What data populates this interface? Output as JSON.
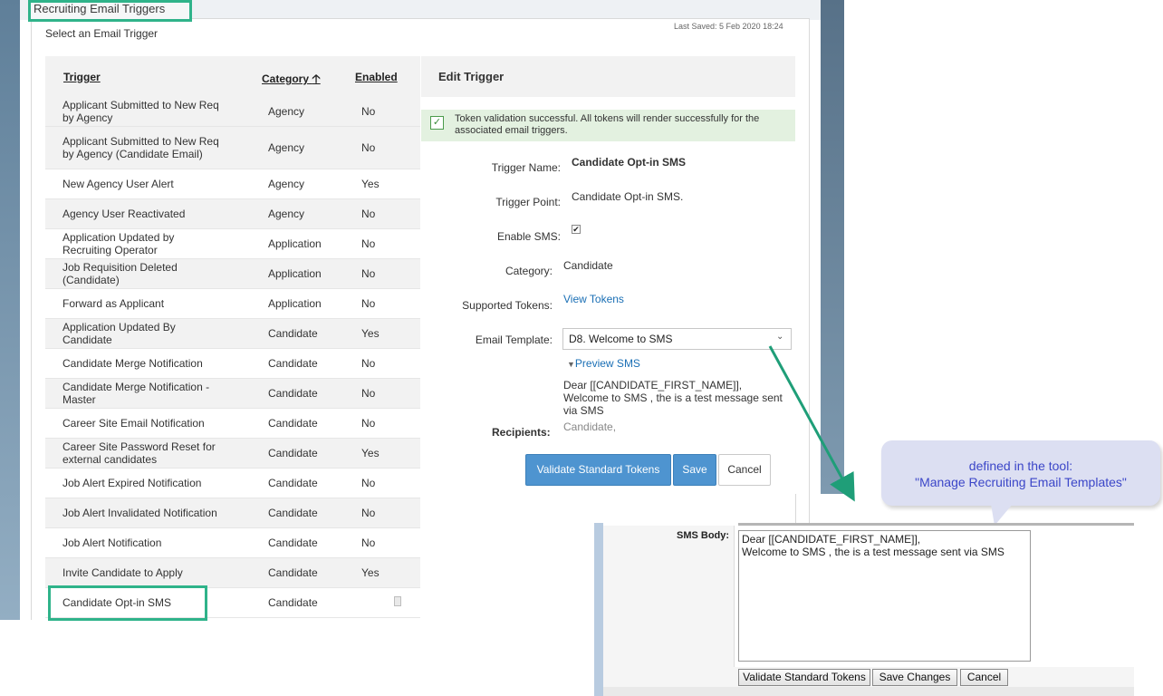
{
  "header": {
    "title": "Recruiting Email Triggers",
    "subtitle": "Select an Email Trigger",
    "last_saved": "Last Saved: 5 Feb 2020 18:24"
  },
  "table": {
    "columns": [
      "Trigger",
      "Category",
      "Enabled"
    ],
    "category_sort_icon": "arrow-up-icon",
    "rows": [
      {
        "name": "Applicant Submitted to New Req by Agency",
        "category": "Agency",
        "enabled": "No"
      },
      {
        "name": "Applicant Submitted to New Req by Agency (Candidate Email)",
        "category": "Agency",
        "enabled": "No"
      },
      {
        "name": "New Agency User Alert",
        "category": "Agency",
        "enabled": "Yes"
      },
      {
        "name": "Agency User Reactivated",
        "category": "Agency",
        "enabled": "No"
      },
      {
        "name": "Application Updated by Recruiting Operator",
        "category": "Application",
        "enabled": "No"
      },
      {
        "name": "Job Requisition Deleted (Candidate)",
        "category": "Application",
        "enabled": "No"
      },
      {
        "name": "Forward as Applicant",
        "category": "Application",
        "enabled": "No"
      },
      {
        "name": "Application Updated By Candidate",
        "category": "Candidate",
        "enabled": "Yes"
      },
      {
        "name": "Candidate Merge Notification",
        "category": "Candidate",
        "enabled": "No"
      },
      {
        "name": "Candidate Merge Notification - Master",
        "category": "Candidate",
        "enabled": "No"
      },
      {
        "name": "Career Site Email Notification",
        "category": "Candidate",
        "enabled": "No"
      },
      {
        "name": "Career Site Password Reset for external candidates",
        "category": "Candidate",
        "enabled": "Yes"
      },
      {
        "name": "Job Alert Expired Notification",
        "category": "Candidate",
        "enabled": "No"
      },
      {
        "name": "Job Alert Invalidated Notification",
        "category": "Candidate",
        "enabled": "No"
      },
      {
        "name": "Job Alert Notification",
        "category": "Candidate",
        "enabled": "No"
      },
      {
        "name": "Invite Candidate to Apply",
        "category": "Candidate",
        "enabled": "Yes"
      },
      {
        "name": "Candidate Opt-in SMS",
        "category": "Candidate",
        "enabled": ""
      }
    ]
  },
  "edit": {
    "title": "Edit Trigger",
    "success_message": "Token validation successful. All tokens will render successfully for the associated email triggers.",
    "trigger_name_label": "Trigger Name:",
    "trigger_name": "Candidate Opt-in SMS",
    "trigger_point_label": "Trigger Point:",
    "trigger_point": "Candidate Opt-in SMS.",
    "enable_sms_label": "Enable SMS:",
    "enable_sms_checked": "✔",
    "category_label": "Category:",
    "category": "Candidate",
    "tokens_label": "Supported Tokens:",
    "view_tokens": "View Tokens",
    "template_label": "Email Template:",
    "template_value": "D8. Welcome to SMS",
    "preview_link": "Preview SMS",
    "preview_lines": [
      "Dear [[CANDIDATE_FIRST_NAME]],",
      "Welcome to SMS , the is a test message sent",
      "via SMS"
    ],
    "recipients_label": "Recipients:",
    "recipients_value": "Candidate,",
    "buttons": {
      "validate": "Validate Standard Tokens",
      "save": "Save",
      "cancel": "Cancel"
    }
  },
  "callout": {
    "line1": "defined in the tool:",
    "line2": "\"Manage Recruiting Email Templates\""
  },
  "sms_editor": {
    "label": "SMS Body:",
    "body_lines": [
      "Dear [[CANDIDATE_FIRST_NAME]],",
      "Welcome to SMS , the is a test message sent via SMS"
    ],
    "buttons": {
      "validate": "Validate Standard Tokens",
      "save": "Save Changes",
      "cancel": "Cancel"
    }
  },
  "colors": {
    "accent_green": "#2fb38a",
    "button_blue": "#4e94d0",
    "link_blue": "#1a6fb5",
    "callout_text": "#3b46c8"
  }
}
